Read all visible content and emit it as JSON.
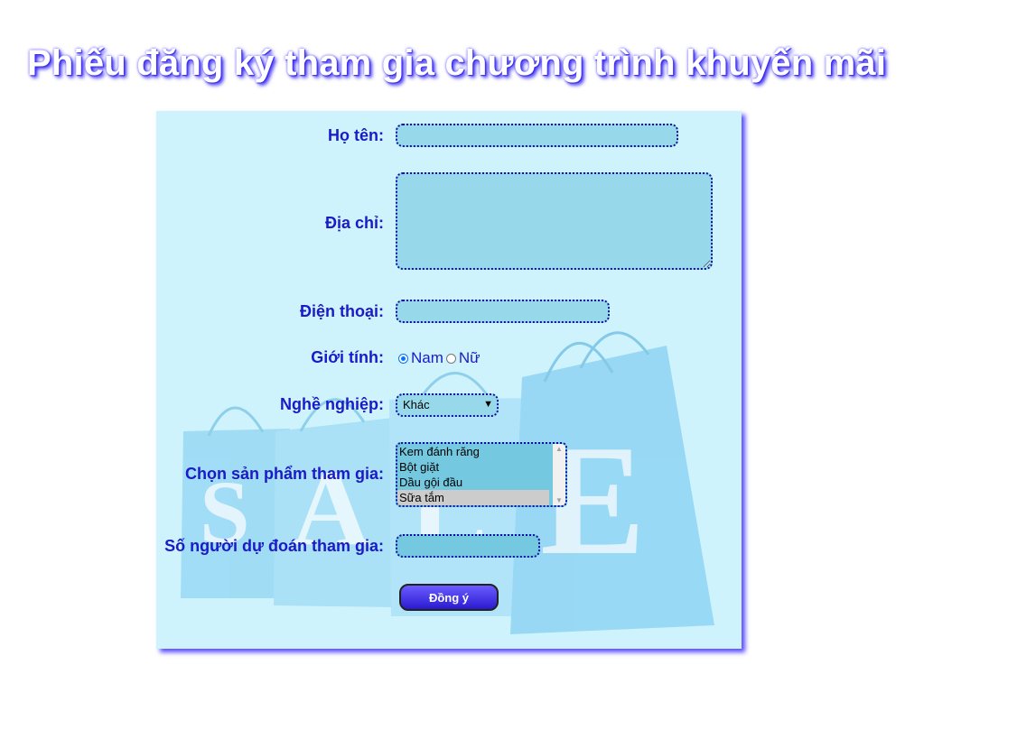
{
  "page": {
    "title": "Phiếu đăng ký tham gia chương trình khuyến mãi"
  },
  "form": {
    "name_label": "Họ tên:",
    "name_value": "",
    "address_label": "Địa chỉ:",
    "address_value": "",
    "phone_label": "Điện thoại:",
    "phone_value": "",
    "gender_label": "Giới tính:",
    "gender_options": [
      "Nam",
      "Nữ"
    ],
    "gender_selected": "Nam",
    "job_label": "Nghề nghiệp:",
    "job_selected": "Khác",
    "products_label": "Chọn sản phẩm tham gia:",
    "products": [
      "Kem đánh răng",
      "Bột giặt",
      "Dầu gội đầu",
      "Sữa tắm"
    ],
    "products_selected": "Sữa tắm",
    "guess_label": "Số người dự đoán tham gia:",
    "guess_value": "",
    "submit_label": "Đồng ý"
  },
  "colors": {
    "panel_bg": "#cff3fc",
    "label_text": "#1a1ac8",
    "field_bg": "#97d9ea",
    "button_bg": "#3a2ae0"
  },
  "icons": [
    "chevron-down-icon",
    "scroll-up-icon",
    "scroll-down-icon"
  ]
}
